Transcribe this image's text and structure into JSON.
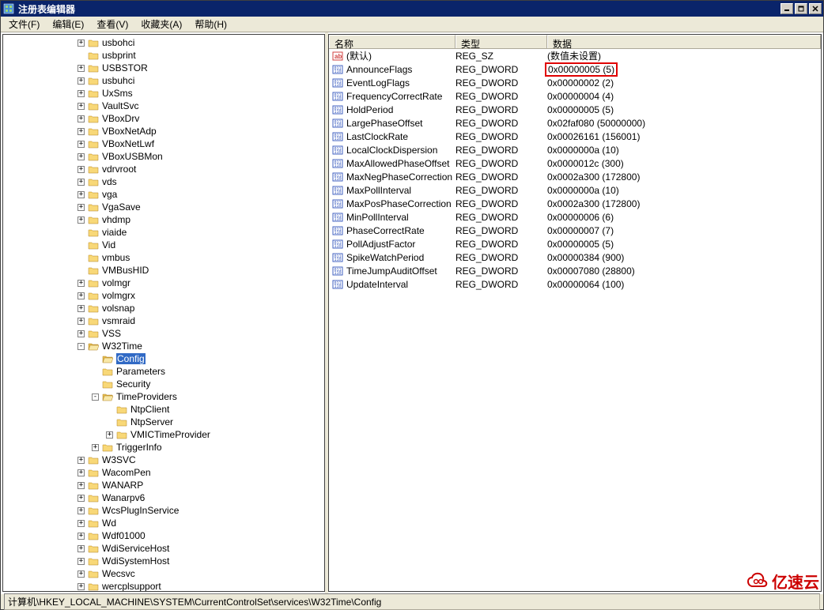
{
  "window": {
    "title": "注册表编辑器"
  },
  "menu": {
    "file": "文件(F)",
    "edit": "编辑(E)",
    "view": "查看(V)",
    "favorites": "收藏夹(A)",
    "help": "帮助(H)"
  },
  "tree": [
    {
      "label": "usbohci",
      "indent": 5,
      "exp": "+"
    },
    {
      "label": "usbprint",
      "indent": 5,
      "exp": ""
    },
    {
      "label": "USBSTOR",
      "indent": 5,
      "exp": "+"
    },
    {
      "label": "usbuhci",
      "indent": 5,
      "exp": "+"
    },
    {
      "label": "UxSms",
      "indent": 5,
      "exp": "+"
    },
    {
      "label": "VaultSvc",
      "indent": 5,
      "exp": "+"
    },
    {
      "label": "VBoxDrv",
      "indent": 5,
      "exp": "+"
    },
    {
      "label": "VBoxNetAdp",
      "indent": 5,
      "exp": "+"
    },
    {
      "label": "VBoxNetLwf",
      "indent": 5,
      "exp": "+"
    },
    {
      "label": "VBoxUSBMon",
      "indent": 5,
      "exp": "+"
    },
    {
      "label": "vdrvroot",
      "indent": 5,
      "exp": "+"
    },
    {
      "label": "vds",
      "indent": 5,
      "exp": "+"
    },
    {
      "label": "vga",
      "indent": 5,
      "exp": "+"
    },
    {
      "label": "VgaSave",
      "indent": 5,
      "exp": "+"
    },
    {
      "label": "vhdmp",
      "indent": 5,
      "exp": "+"
    },
    {
      "label": "viaide",
      "indent": 5,
      "exp": ""
    },
    {
      "label": "Vid",
      "indent": 5,
      "exp": ""
    },
    {
      "label": "vmbus",
      "indent": 5,
      "exp": ""
    },
    {
      "label": "VMBusHID",
      "indent": 5,
      "exp": ""
    },
    {
      "label": "volmgr",
      "indent": 5,
      "exp": "+"
    },
    {
      "label": "volmgrx",
      "indent": 5,
      "exp": "+"
    },
    {
      "label": "volsnap",
      "indent": 5,
      "exp": "+"
    },
    {
      "label": "vsmraid",
      "indent": 5,
      "exp": "+"
    },
    {
      "label": "VSS",
      "indent": 5,
      "exp": "+"
    },
    {
      "label": "W32Time",
      "indent": 5,
      "exp": "-"
    },
    {
      "label": "Config",
      "indent": 6,
      "exp": "",
      "selected": true
    },
    {
      "label": "Parameters",
      "indent": 6,
      "exp": ""
    },
    {
      "label": "Security",
      "indent": 6,
      "exp": ""
    },
    {
      "label": "TimeProviders",
      "indent": 6,
      "exp": "-"
    },
    {
      "label": "NtpClient",
      "indent": 7,
      "exp": ""
    },
    {
      "label": "NtpServer",
      "indent": 7,
      "exp": ""
    },
    {
      "label": "VMICTimeProvider",
      "indent": 7,
      "exp": "+"
    },
    {
      "label": "TriggerInfo",
      "indent": 6,
      "exp": "+"
    },
    {
      "label": "W3SVC",
      "indent": 5,
      "exp": "+"
    },
    {
      "label": "WacomPen",
      "indent": 5,
      "exp": "+"
    },
    {
      "label": "WANARP",
      "indent": 5,
      "exp": "+"
    },
    {
      "label": "Wanarpv6",
      "indent": 5,
      "exp": "+"
    },
    {
      "label": "WcsPlugInService",
      "indent": 5,
      "exp": "+"
    },
    {
      "label": "Wd",
      "indent": 5,
      "exp": "+"
    },
    {
      "label": "Wdf01000",
      "indent": 5,
      "exp": "+"
    },
    {
      "label": "WdiServiceHost",
      "indent": 5,
      "exp": "+"
    },
    {
      "label": "WdiSystemHost",
      "indent": 5,
      "exp": "+"
    },
    {
      "label": "Wecsvc",
      "indent": 5,
      "exp": "+"
    },
    {
      "label": "wercplsupport",
      "indent": 5,
      "exp": "+"
    }
  ],
  "list_header": {
    "name": "名称",
    "type": "类型",
    "data": "数据"
  },
  "values": [
    {
      "name": "(默认)",
      "type": "REG_SZ",
      "data": "(数值未设置)",
      "icon": "string"
    },
    {
      "name": "AnnounceFlags",
      "type": "REG_DWORD",
      "data": "0x00000005 (5)",
      "icon": "binary",
      "highlight": true
    },
    {
      "name": "EventLogFlags",
      "type": "REG_DWORD",
      "data": "0x00000002 (2)",
      "icon": "binary"
    },
    {
      "name": "FrequencyCorrectRate",
      "type": "REG_DWORD",
      "data": "0x00000004 (4)",
      "icon": "binary"
    },
    {
      "name": "HoldPeriod",
      "type": "REG_DWORD",
      "data": "0x00000005 (5)",
      "icon": "binary"
    },
    {
      "name": "LargePhaseOffset",
      "type": "REG_DWORD",
      "data": "0x02faf080 (50000000)",
      "icon": "binary"
    },
    {
      "name": "LastClockRate",
      "type": "REG_DWORD",
      "data": "0x00026161 (156001)",
      "icon": "binary"
    },
    {
      "name": "LocalClockDispersion",
      "type": "REG_DWORD",
      "data": "0x0000000a (10)",
      "icon": "binary"
    },
    {
      "name": "MaxAllowedPhaseOffset",
      "type": "REG_DWORD",
      "data": "0x0000012c (300)",
      "icon": "binary"
    },
    {
      "name": "MaxNegPhaseCorrection",
      "type": "REG_DWORD",
      "data": "0x0002a300 (172800)",
      "icon": "binary"
    },
    {
      "name": "MaxPollInterval",
      "type": "REG_DWORD",
      "data": "0x0000000a (10)",
      "icon": "binary"
    },
    {
      "name": "MaxPosPhaseCorrection",
      "type": "REG_DWORD",
      "data": "0x0002a300 (172800)",
      "icon": "binary"
    },
    {
      "name": "MinPollInterval",
      "type": "REG_DWORD",
      "data": "0x00000006 (6)",
      "icon": "binary"
    },
    {
      "name": "PhaseCorrectRate",
      "type": "REG_DWORD",
      "data": "0x00000007 (7)",
      "icon": "binary"
    },
    {
      "name": "PollAdjustFactor",
      "type": "REG_DWORD",
      "data": "0x00000005 (5)",
      "icon": "binary"
    },
    {
      "name": "SpikeWatchPeriod",
      "type": "REG_DWORD",
      "data": "0x00000384 (900)",
      "icon": "binary"
    },
    {
      "name": "TimeJumpAuditOffset",
      "type": "REG_DWORD",
      "data": "0x00007080 (28800)",
      "icon": "binary"
    },
    {
      "name": "UpdateInterval",
      "type": "REG_DWORD",
      "data": "0x00000064 (100)",
      "icon": "binary"
    }
  ],
  "statusbar": {
    "path": "计算机\\HKEY_LOCAL_MACHINE\\SYSTEM\\CurrentControlSet\\services\\W32Time\\Config"
  },
  "watermark": {
    "text": "亿速云"
  }
}
